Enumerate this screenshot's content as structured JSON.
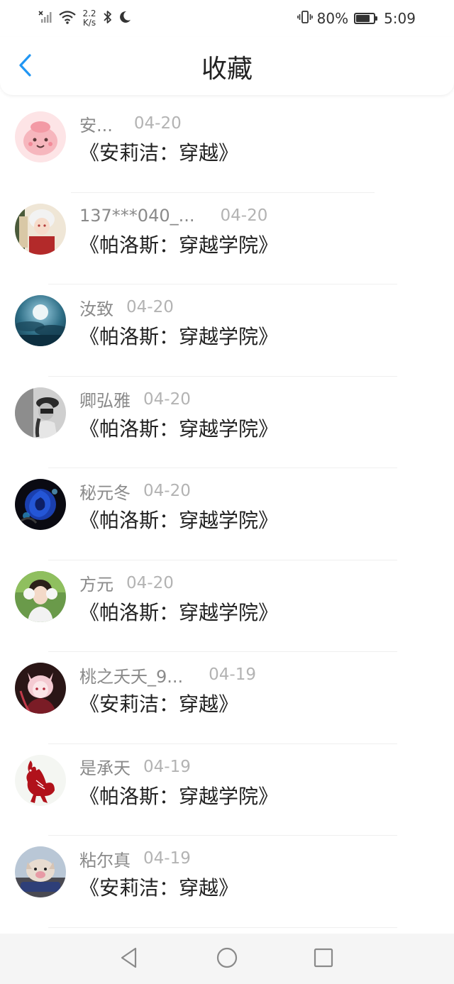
{
  "status_bar": {
    "net_speed_value": "2.2",
    "net_speed_unit": "K/s",
    "battery_percent": "80%",
    "battery_level": 0.8,
    "time": "5:09",
    "icons": [
      "no-signal-icon",
      "wifi-icon",
      "bluetooth-icon",
      "moon-icon",
      "vibrate-icon",
      "battery-icon"
    ]
  },
  "header": {
    "title": "收藏",
    "back_icon": "chevron-left-icon",
    "accent_color": "#2196f3"
  },
  "list": {
    "items": [
      {
        "username": "安...",
        "date": "04-20",
        "title": "《安莉洁：穿越》"
      },
      {
        "username": "137***040_...",
        "date": "04-20",
        "title": "《帕洛斯：穿越学院》"
      },
      {
        "username": "汝致",
        "date": "04-20",
        "title": "《帕洛斯：穿越学院》"
      },
      {
        "username": "卿弘雅",
        "date": "04-20",
        "title": "《帕洛斯：穿越学院》"
      },
      {
        "username": "秘元冬",
        "date": "04-20",
        "title": "《帕洛斯：穿越学院》"
      },
      {
        "username": "方元",
        "date": "04-20",
        "title": "《帕洛斯：穿越学院》"
      },
      {
        "username": "桃之夭夭_9...",
        "date": "04-19",
        "title": "《安莉洁：穿越》"
      },
      {
        "username": "是承天",
        "date": "04-19",
        "title": "《帕洛斯：穿越学院》"
      },
      {
        "username": "粘尔真",
        "date": "04-19",
        "title": "《安莉洁：穿越》"
      }
    ]
  },
  "nav_bar": {
    "icons": [
      "back-triangle-icon",
      "home-circle-icon",
      "recents-square-icon"
    ]
  }
}
